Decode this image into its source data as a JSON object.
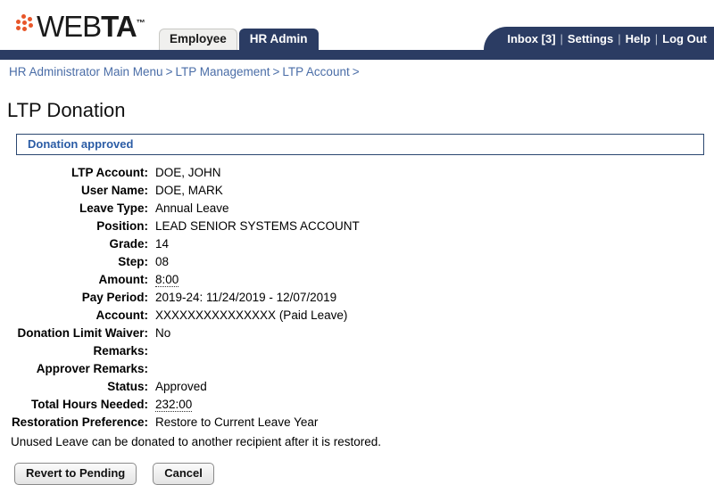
{
  "brand": {
    "name_web": "WEB",
    "name_ta": "TA",
    "tm": "™",
    "dots_icon": "webta-dots-logo",
    "accent_color": "#e8562a",
    "navy_color": "#2b3c63"
  },
  "tabs": [
    {
      "label": "Employee",
      "active": false
    },
    {
      "label": "HR Admin",
      "active": true
    }
  ],
  "topnav": {
    "inbox": "Inbox [3]",
    "sep1": "|",
    "settings": "Settings",
    "sep2": "|",
    "help": "Help",
    "sep3": "|",
    "logout": "Log Out"
  },
  "breadcrumb": {
    "items": [
      {
        "label": "HR Administrator Main Menu"
      },
      {
        "label": "LTP Management"
      },
      {
        "label": "LTP Account"
      }
    ],
    "separator": ">",
    "trailing": ">"
  },
  "page": {
    "title": "LTP Donation",
    "message": "Donation approved",
    "note": "Unused Leave can be donated to another recipient after it is restored."
  },
  "details": [
    {
      "label": "LTP Account:",
      "value": "DOE, JOHN",
      "hint": false
    },
    {
      "label": "User Name:",
      "value": "DOE, MARK",
      "hint": false
    },
    {
      "label": "Leave Type:",
      "value": "Annual Leave",
      "hint": false
    },
    {
      "label": "Position:",
      "value": "LEAD SENIOR SYSTEMS ACCOUNT",
      "hint": false
    },
    {
      "label": "Grade:",
      "value": "14",
      "hint": false
    },
    {
      "label": "Step:",
      "value": "08",
      "hint": false
    },
    {
      "label": "Amount:",
      "value": "8:00",
      "hint": true
    },
    {
      "label": "Pay Period:",
      "value": "2019-24: 11/24/2019 - 12/07/2019",
      "hint": false
    },
    {
      "label": "Account:",
      "value": "XXXXXXXXXXXXXXX (Paid Leave)",
      "hint": false
    },
    {
      "label": "Donation Limit Waiver:",
      "value": "No",
      "hint": false
    },
    {
      "label": "Remarks:",
      "value": "",
      "hint": false
    },
    {
      "label": "Approver Remarks:",
      "value": "",
      "hint": false
    },
    {
      "label": "Status:",
      "value": "Approved",
      "hint": false
    },
    {
      "label": "Total Hours Needed:",
      "value": "232:00",
      "hint": true
    },
    {
      "label": "Restoration Preference:",
      "value": "Restore to Current Leave Year",
      "hint": false
    }
  ],
  "buttons": [
    {
      "label": "Revert to Pending",
      "name": "revert-to-pending-button"
    },
    {
      "label": "Cancel",
      "name": "cancel-button"
    }
  ]
}
